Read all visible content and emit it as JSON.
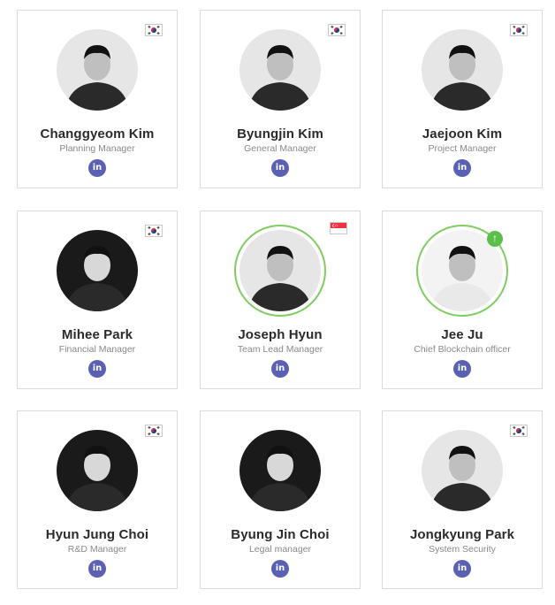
{
  "members": [
    {
      "name": "Changgyeom Kim",
      "role": "Planning Manager",
      "flag": "korea",
      "photo_style": "light",
      "linkedin_icon": "in"
    },
    {
      "name": "Byungjin Kim",
      "role": "General Manager",
      "flag": "korea",
      "photo_style": "light",
      "linkedin_icon": "in"
    },
    {
      "name": "Jaejoon Kim",
      "role": "Project Manager",
      "flag": "korea",
      "photo_style": "light",
      "linkedin_icon": "in"
    },
    {
      "name": "Mihee Park",
      "role": "Financial Manager",
      "flag": "korea",
      "photo_style": "dark",
      "linkedin_icon": "in"
    },
    {
      "name": "Joseph Hyun",
      "role": "Team Lead Manager",
      "flag": "singapore",
      "photo_style": "ringed",
      "linkedin_icon": "in"
    },
    {
      "name": "Jee Ju",
      "role": "Chief Blockchain officer",
      "flag": "none",
      "photo_style": "ringed-up",
      "up_icon": "↑",
      "linkedin_icon": "in"
    },
    {
      "name": "Hyun Jung Choi",
      "role": "R&D Manager",
      "flag": "korea",
      "photo_style": "dark",
      "linkedin_icon": "in"
    },
    {
      "name": "Byung Jin Choi",
      "role": "Legal manager",
      "flag": "none",
      "photo_style": "dark",
      "linkedin_icon": "in"
    },
    {
      "name": "Jongkyung Park",
      "role": "System Security",
      "flag": "korea",
      "photo_style": "light",
      "linkedin_icon": "in"
    }
  ],
  "colors": {
    "linkedin": "#5a61b4",
    "ring": "#7fcc61",
    "up_badge": "#5cbf4a"
  }
}
